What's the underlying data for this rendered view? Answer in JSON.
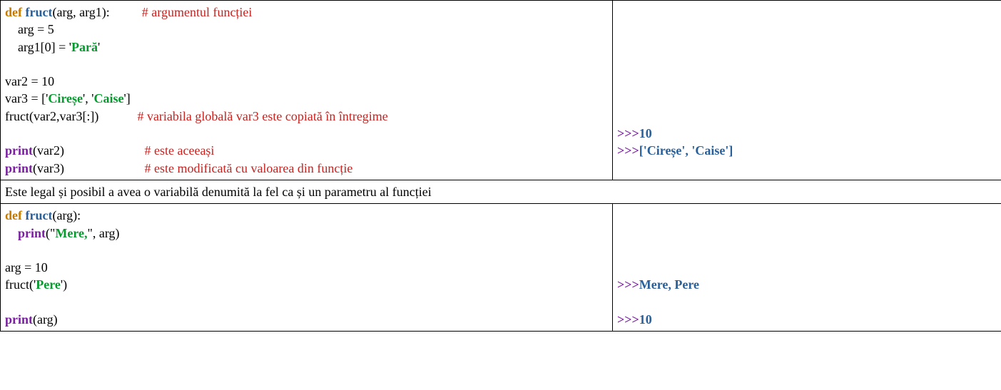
{
  "row1": {
    "code": {
      "def": "def",
      "fname": "fruct",
      "sig1": "(arg, arg1):          ",
      "cmt1": "# argumentul funcției",
      "l2": "    arg = 5",
      "l3a": "    arg1[0] = '",
      "l3str": "Pară",
      "l3b": "'",
      "blank1": "",
      "l5": "var2 = 10",
      "l6a": "var3 = ['",
      "l6s1": "Cireșe",
      "l6mid": "', '",
      "l6s2": "Caise",
      "l6end": "']",
      "l7a": "fruct(var2,var3[:])            ",
      "cmt2": "# variabila globală var3 este copiată în întregime",
      "blank2": "",
      "l9a": "print",
      "l9b": "(var2)                         ",
      "cmt3": "# este aceeași",
      "l10a": "print",
      "l10b": "(var3)                         ",
      "cmt4": "# este modificată cu valoarea din funcție"
    },
    "out": {
      "prompt": ">>>",
      "v1": "10",
      "v2": "['Cireșe', 'Caise']"
    }
  },
  "row2": {
    "text": "Este legal și posibil a avea o variabilă denumită la fel ca și un parametru al funcției"
  },
  "row3": {
    "code": {
      "def": "def",
      "fname": "fruct",
      "sig": "(arg):",
      "l2a": "    ",
      "l2print": "print",
      "l2b": "(\"",
      "l2str": "Mere,",
      "l2c": "\", arg)",
      "blank1": "",
      "l4": "arg = 10",
      "l5a": "fruct('",
      "l5str": "Pere",
      "l5b": "')",
      "blank2": "",
      "l7print": "print",
      "l7b": "(arg)"
    },
    "out": {
      "prompt": ">>>",
      "v1": "Mere, Pere",
      "v2": "10"
    }
  }
}
